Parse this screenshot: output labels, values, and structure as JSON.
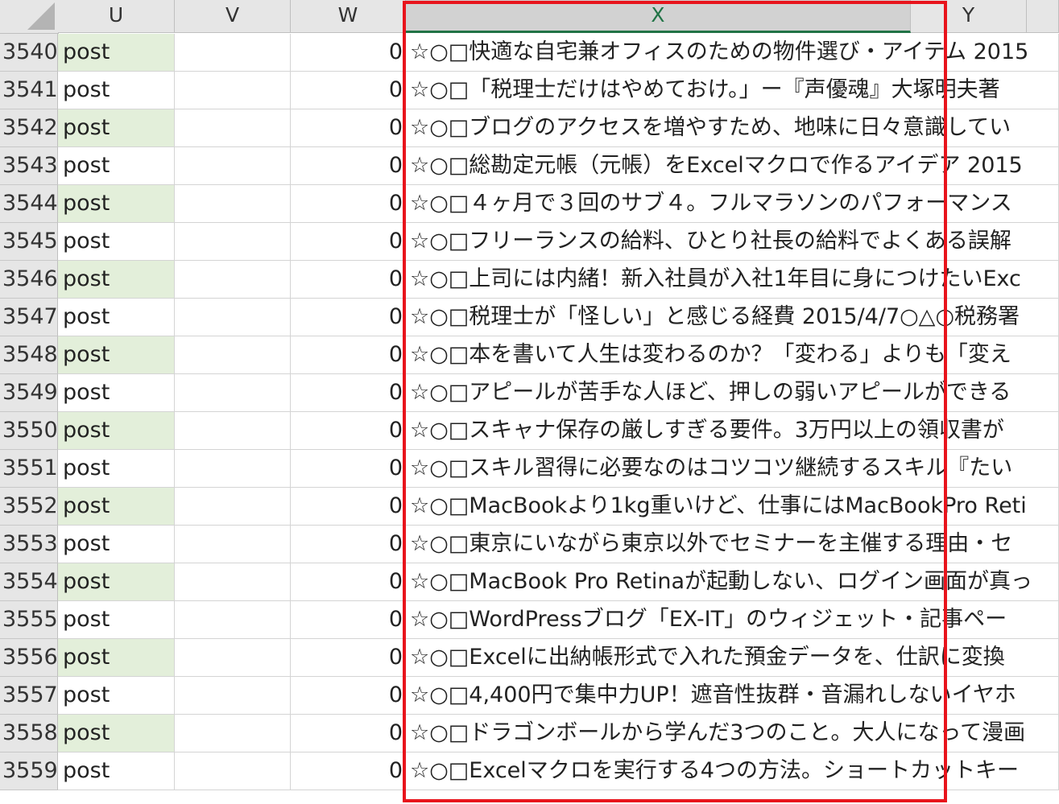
{
  "columns": [
    {
      "label": "U"
    },
    {
      "label": "V"
    },
    {
      "label": "W"
    },
    {
      "label": "X"
    },
    {
      "label": "Y"
    }
  ],
  "selected_column": "X",
  "rows": [
    {
      "num": "3540",
      "u": "post",
      "w": "0",
      "x": "☆○□快適な自宅兼オフィスのための物件選び・アイテム 2015"
    },
    {
      "num": "3541",
      "u": "post",
      "w": "0",
      "x": "☆○□「税理士だけはやめておけ。」ー『声優魂』大塚明夫著"
    },
    {
      "num": "3542",
      "u": "post",
      "w": "0",
      "x": "☆○□ブログのアクセスを増やすため、地味に日々意識してい"
    },
    {
      "num": "3543",
      "u": "post",
      "w": "0",
      "x": "☆○□総勘定元帳（元帳）をExcelマクロで作るアイデア 2015"
    },
    {
      "num": "3544",
      "u": "post",
      "w": "0",
      "x": "☆○□４ヶ月で３回のサブ４。フルマラソンのパフォーマンス"
    },
    {
      "num": "3545",
      "u": "post",
      "w": "0",
      "x": "☆○□フリーランスの給料、ひとり社長の給料でよくある誤解"
    },
    {
      "num": "3546",
      "u": "post",
      "w": "0",
      "x": "☆○□上司には内緒！新入社員が入社1年目に身につけたいExc"
    },
    {
      "num": "3547",
      "u": "post",
      "w": "0",
      "x": "☆○□税理士が「怪しい」と感じる経費 2015/4/7○△○税務署"
    },
    {
      "num": "3548",
      "u": "post",
      "w": "0",
      "x": "☆○□本を書いて人生は変わるのか？「変わる」よりも「変え"
    },
    {
      "num": "3549",
      "u": "post",
      "w": "0",
      "x": "☆○□アピールが苦手な人ほど、押しの弱いアピールができる"
    },
    {
      "num": "3550",
      "u": "post",
      "w": "0",
      "x": "☆○□スキャナ保存の厳しすぎる要件。3万円以上の領収書が"
    },
    {
      "num": "3551",
      "u": "post",
      "w": "0",
      "x": "☆○□スキル習得に必要なのはコツコツ継続するスキル『たい"
    },
    {
      "num": "3552",
      "u": "post",
      "w": "0",
      "x": "☆○□MacBookより1kg重いけど、仕事にはMacBookPro Reti"
    },
    {
      "num": "3553",
      "u": "post",
      "w": "0",
      "x": "☆○□東京にいながら東京以外でセミナーを主催する理由・セ"
    },
    {
      "num": "3554",
      "u": "post",
      "w": "0",
      "x": "☆○□MacBook Pro Retinaが起動しない、ログイン画面が真っ"
    },
    {
      "num": "3555",
      "u": "post",
      "w": "0",
      "x": "☆○□WordPressブログ「EX-IT」のウィジェット・記事ペー"
    },
    {
      "num": "3556",
      "u": "post",
      "w": "0",
      "x": "☆○□Excelに出納帳形式で入れた預金データを、仕訳に変換"
    },
    {
      "num": "3557",
      "u": "post",
      "w": "0",
      "x": "☆○□4,400円で集中力UP！遮音性抜群・音漏れしないイヤホ"
    },
    {
      "num": "3558",
      "u": "post",
      "w": "0",
      "x": "☆○□ドラゴンボールから学んだ3つのこと。大人になって漫画"
    },
    {
      "num": "3559",
      "u": "post",
      "w": "0",
      "x": "☆○□Excelマクロを実行する4つの方法。ショートカットキー"
    }
  ],
  "colors": {
    "band": "#e3efda",
    "highlight": "#e8141c",
    "selected_header_text": "#217346"
  }
}
